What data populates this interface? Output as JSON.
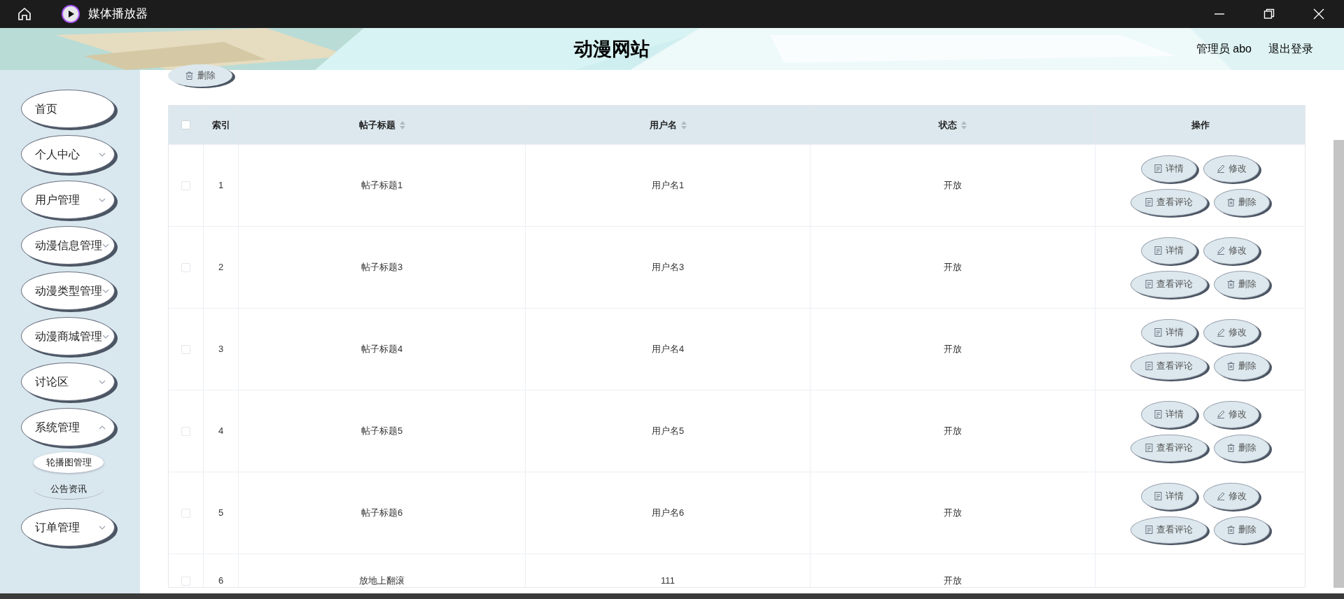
{
  "window": {
    "title": "媒体播放器"
  },
  "header": {
    "title": "动漫网站",
    "user": "管理员 abo",
    "logout": "退出登录"
  },
  "sidebar": {
    "items": [
      {
        "label": "首页",
        "kind": "link"
      },
      {
        "label": "个人中心",
        "kind": "menu",
        "expanded": false
      },
      {
        "label": "用户管理",
        "kind": "menu",
        "expanded": false
      },
      {
        "label": "动漫信息管理",
        "kind": "menu",
        "expanded": false
      },
      {
        "label": "动漫类型管理",
        "kind": "menu",
        "expanded": false
      },
      {
        "label": "动漫商城管理",
        "kind": "menu",
        "expanded": false
      },
      {
        "label": "讨论区",
        "kind": "menu",
        "expanded": false
      },
      {
        "label": "系统管理",
        "kind": "menu",
        "expanded": true,
        "children": [
          {
            "label": "轮播图管理",
            "selected": true
          },
          {
            "label": "公告资讯",
            "selected": false
          }
        ]
      },
      {
        "label": "订单管理",
        "kind": "menu",
        "expanded": false
      }
    ]
  },
  "toolbar": {
    "delete": "删除"
  },
  "table": {
    "select_all": {
      "checked": false
    },
    "columns": [
      {
        "label": "索引",
        "sortable": false
      },
      {
        "label": "帖子标题",
        "sortable": true
      },
      {
        "label": "用户名",
        "sortable": true
      },
      {
        "label": "状态",
        "sortable": true
      },
      {
        "label": "操作",
        "sortable": false
      }
    ],
    "rows": [
      {
        "checked": false,
        "index": "1",
        "title": "帖子标题1",
        "user": "用户名1",
        "status": "开放",
        "actions": [
          "详情",
          "修改",
          "查看评论",
          "删除"
        ]
      },
      {
        "checked": false,
        "index": "2",
        "title": "帖子标题3",
        "user": "用户名3",
        "status": "开放",
        "actions": [
          "详情",
          "修改",
          "查看评论",
          "删除"
        ]
      },
      {
        "checked": false,
        "index": "3",
        "title": "帖子标题4",
        "user": "用户名4",
        "status": "开放",
        "actions": [
          "详情",
          "修改",
          "查看评论",
          "删除"
        ]
      },
      {
        "checked": false,
        "index": "4",
        "title": "帖子标题5",
        "user": "用户名5",
        "status": "开放",
        "actions": [
          "详情",
          "修改",
          "查看评论",
          "删除"
        ]
      },
      {
        "checked": false,
        "index": "5",
        "title": "帖子标题6",
        "user": "用户名6",
        "status": "开放",
        "actions": [
          "详情",
          "修改",
          "查看评论",
          "删除"
        ]
      },
      {
        "checked": false,
        "index": "6",
        "title": "放地上翻滚",
        "user": "111",
        "status": "开放"
      }
    ]
  }
}
